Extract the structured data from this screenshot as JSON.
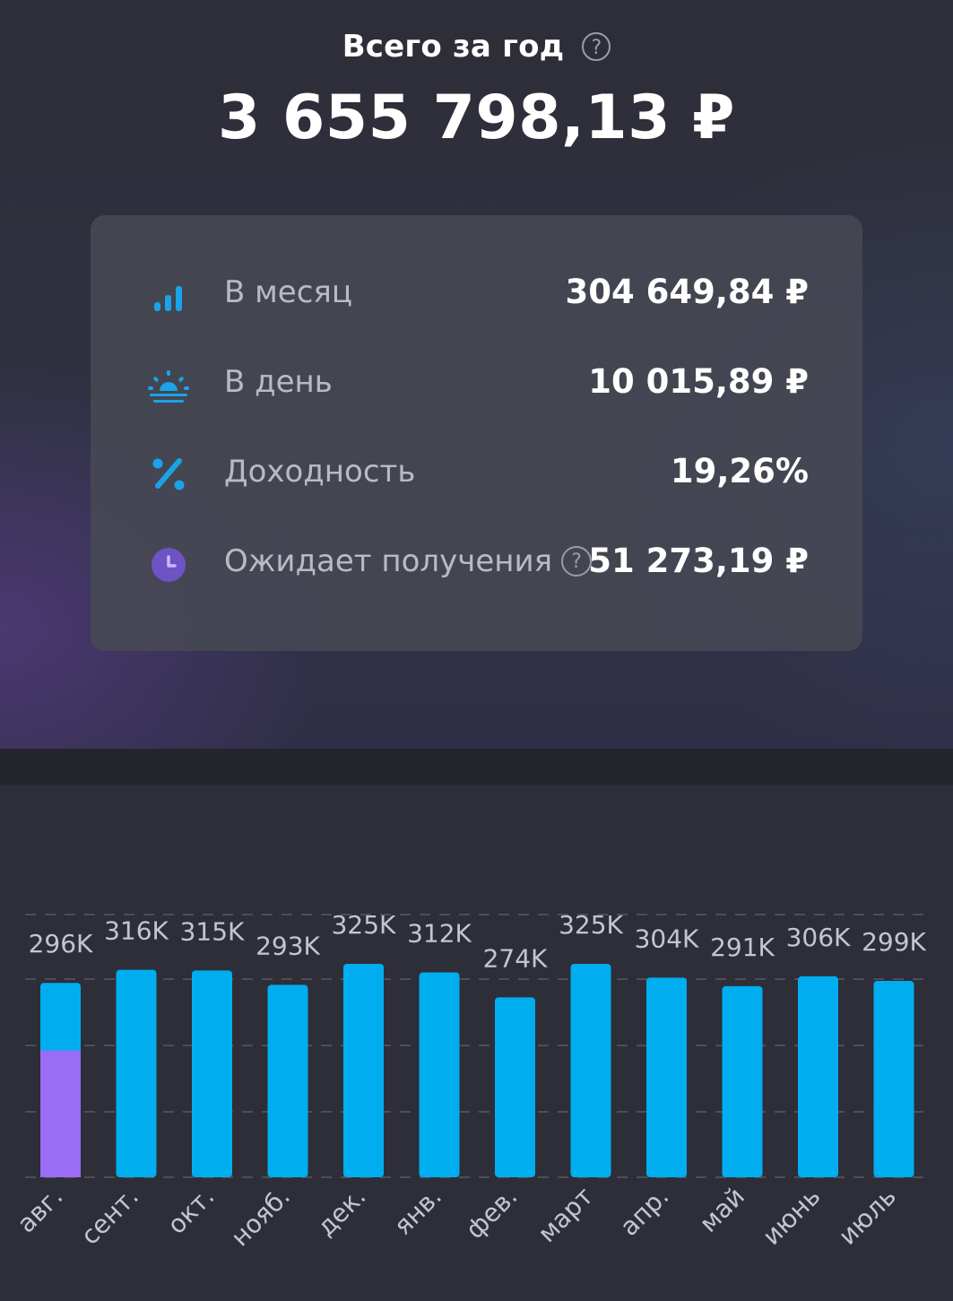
{
  "header": {
    "title": "Всего за год",
    "total": "3 655 798,13 ₽"
  },
  "stats": [
    {
      "label": "В месяц",
      "value": "304 649,84 ₽",
      "icon": "bar-chart-icon",
      "has_help": false
    },
    {
      "label": "В день",
      "value": "10 015,89 ₽",
      "icon": "sunrise-icon",
      "has_help": false
    },
    {
      "label": "Доходность",
      "value": "19,26%",
      "icon": "percent-icon",
      "has_help": false
    },
    {
      "label": "Ожидает получения",
      "value": "51 273,19 ₽",
      "icon": "clock-icon",
      "has_help": true
    }
  ],
  "colors": {
    "bar": "#00aef0",
    "bar_highlight": "#9b6cf4",
    "accent": "#1aa3e8",
    "clock": "#6d53c4"
  },
  "chart_data": {
    "type": "bar",
    "categories": [
      "авг.",
      "сент.",
      "окт.",
      "нояб.",
      "дек.",
      "янв.",
      "фев.",
      "март",
      "апр.",
      "май",
      "июнь",
      "июль"
    ],
    "values": [
      296,
      316,
      315,
      293,
      325,
      312,
      274,
      325,
      304,
      291,
      306,
      299
    ],
    "value_labels": [
      "296K",
      "316K",
      "315K",
      "293K",
      "325K",
      "312K",
      "274K",
      "325K",
      "304K",
      "291K",
      "306K",
      "299K"
    ],
    "stacked_first_bar": {
      "bottom_value": 193
    },
    "grid": true
  }
}
